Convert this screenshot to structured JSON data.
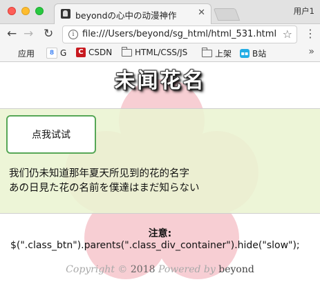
{
  "browser": {
    "tab_title": "beyondの心中の动漫神作",
    "tab_close": "✕",
    "user_label": "用户1",
    "url": "file:///Users/beyond/sg_html/html_531.html",
    "nav": {
      "back": "←",
      "forward": "→",
      "reload": "↻",
      "info": "i",
      "star": "☆",
      "menu": "⋮"
    },
    "bookmarks": {
      "apps": "应用",
      "google": "G",
      "csdn": "CSDN",
      "html": "HTML/CSS/JS",
      "shangjia": "上架",
      "bzhan": "B站",
      "more": "»"
    }
  },
  "page": {
    "title": "未闻花名",
    "button_label": "点我试试",
    "poem_lines": [
      "我们仍未知道那年夏天所见到的花的名字",
      "あの日見た花の名前を僕達はまだ知らない"
    ],
    "note_label": "注意:",
    "note_code": "$(\".class_btn\").parents(\".class_div_container\").hide(\"slow\");",
    "footer": {
      "copyright": "Copyright ©",
      "year": "2018",
      "powered": "Powered by",
      "author": "beyond"
    }
  }
}
